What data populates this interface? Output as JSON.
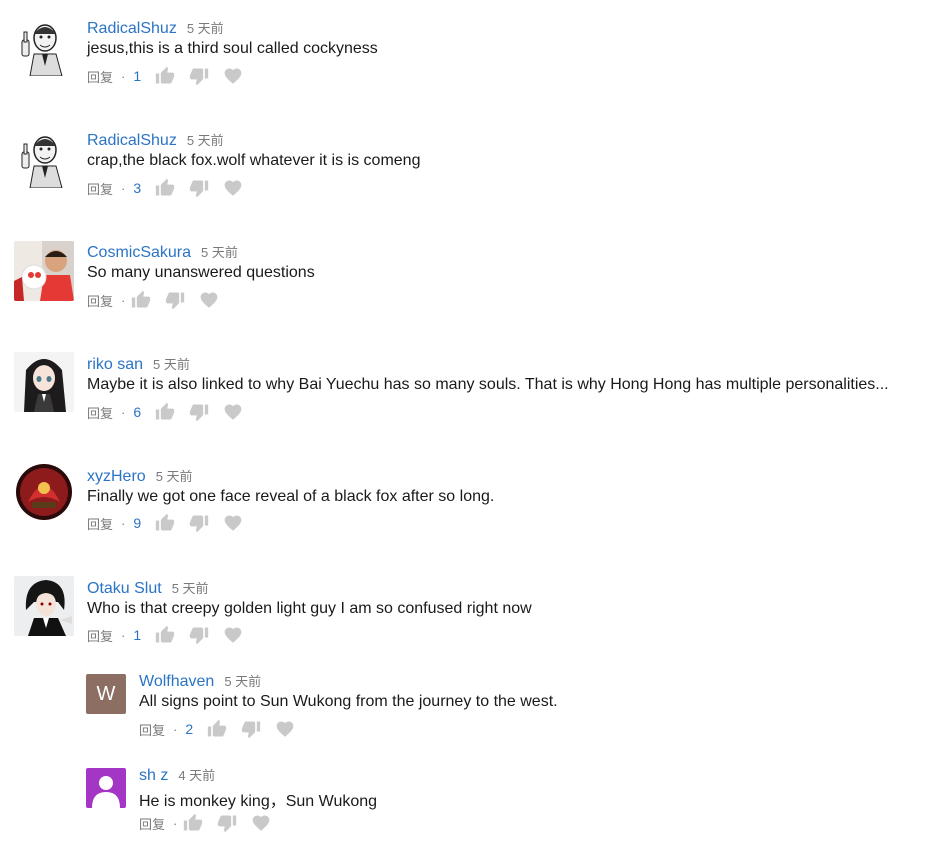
{
  "ui": {
    "reply_label": "回复",
    "dot": "·"
  },
  "colors": {
    "author": "#2b74c5",
    "muted": "#7a7a7a",
    "icon": "#c9c9c9",
    "text": "#1a1a1a"
  },
  "comments": [
    {
      "author": "RadicalShuz",
      "time": "5 天前",
      "text": "jesus,this is a third soul called cockyness",
      "likes": "1",
      "avatar_icon": "meme-man-thumbs-up-avatar"
    },
    {
      "author": "RadicalShuz",
      "time": "5 天前",
      "text": "crap,the black fox.wolf whatever it is is comeng",
      "likes": "3",
      "avatar_icon": "meme-man-thumbs-up-avatar"
    },
    {
      "author": "CosmicSakura",
      "time": "5 天前",
      "text": "So many unanswered questions",
      "likes": "",
      "avatar_icon": "person-with-plush-avatar"
    },
    {
      "author": "riko san",
      "time": "5 天前",
      "text": "Maybe it is also linked to why Bai Yuechu has so many souls. That is why Hong Hong has multiple personalities...",
      "likes": "6",
      "avatar_icon": "anime-girl-avatar"
    },
    {
      "author": "xyzHero",
      "time": "5 天前",
      "text": "Finally we got one face reveal of a black fox after so long.",
      "likes": "9",
      "avatar_icon": "red-emblem-avatar"
    },
    {
      "author": "Otaku Slut",
      "time": "5 天前",
      "text": "Who is that creepy golden light guy I am so confused right now",
      "likes": "1",
      "avatar_icon": "anime-butler-avatar"
    }
  ],
  "replies": [
    {
      "author": "Wolfhaven",
      "time": "5 天前",
      "text": "All signs point to Sun Wukong from the journey to the west.",
      "likes": "2",
      "avatar_letter": "W",
      "avatar_color": "#8d6e63"
    },
    {
      "author": "sh z",
      "time": "4 天前",
      "text": "He is monkey king，Sun Wukong",
      "likes": "",
      "avatar_icon": "default-user-avatar",
      "avatar_color": "#a336c4"
    }
  ]
}
